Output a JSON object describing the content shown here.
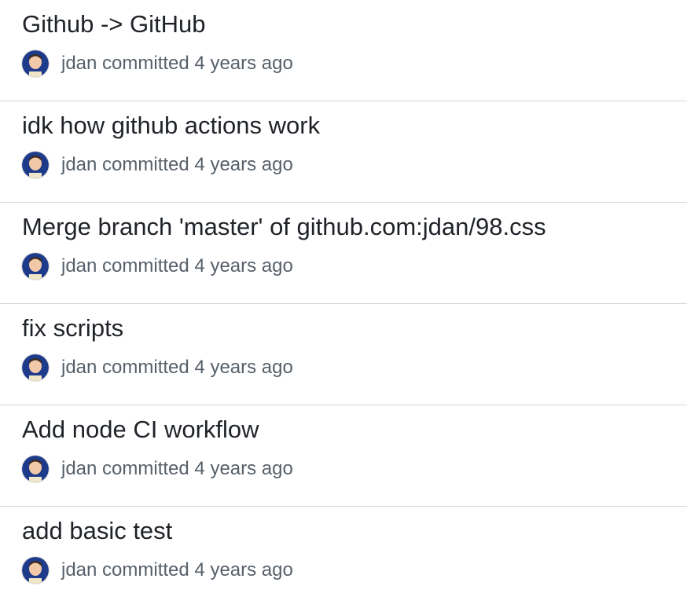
{
  "commits": [
    {
      "title": "Github -> GitHub",
      "author": "jdan",
      "verb": "committed",
      "time": "4 years ago"
    },
    {
      "title": "idk how github actions work",
      "author": "jdan",
      "verb": "committed",
      "time": "4 years ago"
    },
    {
      "title": "Merge branch 'master' of github.com:jdan/98.css",
      "author": "jdan",
      "verb": "committed",
      "time": "4 years ago"
    },
    {
      "title": "fix scripts",
      "author": "jdan",
      "verb": "committed",
      "time": "4 years ago"
    },
    {
      "title": "Add node CI workflow",
      "author": "jdan",
      "verb": "committed",
      "time": "4 years ago"
    },
    {
      "title": "add basic test",
      "author": "jdan",
      "verb": "committed",
      "time": "4 years ago"
    }
  ],
  "colors": {
    "title": "#1f2328",
    "meta": "#57606a",
    "divider": "#d0d7de",
    "avatar_bg": "#1e3a8a"
  }
}
